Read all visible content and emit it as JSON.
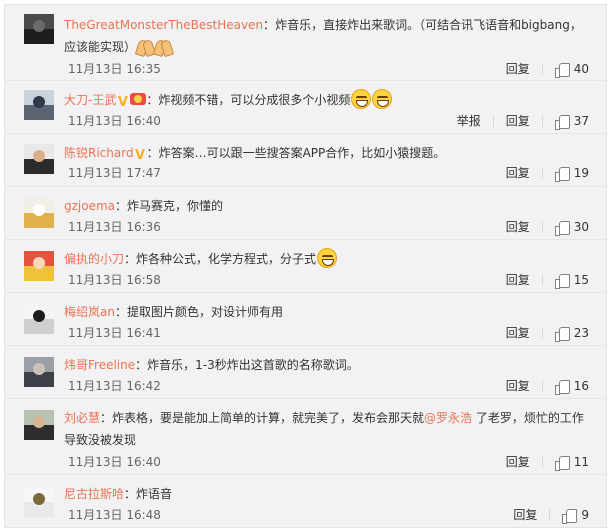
{
  "comments": [
    {
      "user": "TheGreatMonsterTheBestHeaven",
      "sep": "：",
      "text": "炸音乐，直接炸出来歌词。（可结合讯飞语音和bigbang，应该能实现）",
      "time": "11月13日 16:35",
      "reply": "回复",
      "likes": "40",
      "avatar": {
        "top": "#4a4a4a",
        "bottom": "#1e1e1e",
        "head": "#6a6a6a"
      }
    },
    {
      "user": "大刀-王武",
      "sep": "：",
      "text": "炸视频不错，可以分成很多个小视频",
      "time": "11月13日 16:40",
      "report": "举报",
      "reply": "回复",
      "likes": "37",
      "avatar": {
        "top": "#c9d3dc",
        "bottom": "#5b6470",
        "head": "#2d3a4a"
      }
    },
    {
      "user": "陈锐Richard",
      "sep": "：",
      "text": "炸答案…可以跟一些搜答案APP合作，比如小猿搜题。",
      "time": "11月13日 17:47",
      "reply": "回复",
      "likes": "19",
      "avatar": {
        "top": "#e8e8e8",
        "bottom": "#2b2b2b",
        "head": "#d9b08a"
      }
    },
    {
      "user": "gzjoema",
      "sep": "：",
      "text": "炸马赛克，你懂的",
      "time": "11月13日 16:36",
      "reply": "回复",
      "likes": "30",
      "avatar": {
        "top": "#f3efe6",
        "bottom": "#e2b24a",
        "head": "#ffffff"
      }
    },
    {
      "user": "偏执的小刀",
      "sep": "：",
      "text": "炸各种公式，化学方程式，分子式",
      "time": "11月13日 16:58",
      "reply": "回复",
      "likes": "15",
      "avatar": {
        "top": "#e3543f",
        "bottom": "#f0c13a",
        "head": "#f7d9b8"
      }
    },
    {
      "user": "梅绍岚an",
      "sep": "：",
      "text": "提取图片颜色，对设计师有用",
      "time": "11月13日 16:41",
      "reply": "回复",
      "likes": "23",
      "avatar": {
        "top": "#f4f4f4",
        "bottom": "#cfcfcf",
        "head": "#1c1c1c"
      }
    },
    {
      "user": "炜哥Freeline",
      "sep": "：",
      "text": "炸音乐，1-3秒炸出这首歌的名称歌词。",
      "time": "11月13日 16:42",
      "reply": "回复",
      "likes": "16",
      "avatar": {
        "top": "#9aa0a6",
        "bottom": "#3e4248",
        "head": "#c9c2b8"
      }
    },
    {
      "user": "刘必慧",
      "sep": "：",
      "text_before": "炸表格，要是能加上简单的计算，就完美了，发布会那天就",
      "mention": "@罗永浩",
      "text_after": " 了老罗，烦忙的工作导致没被发现",
      "time": "11月13日 16:40",
      "reply": "回复",
      "likes": "11",
      "avatar": {
        "top": "#b8c2b0",
        "bottom": "#2c2c2c",
        "head": "#d6b592"
      }
    },
    {
      "user": "尼古拉斯哈",
      "sep": "：",
      "text": "炸语音",
      "time": "11月13日 16:48",
      "reply": "回复",
      "likes": "9",
      "avatar": {
        "top": "#f6f6f6",
        "bottom": "#e9e9e9",
        "head": "#7a6a3a"
      }
    }
  ],
  "colors": {
    "username": "#eb7350",
    "panel": "#f2f2f5",
    "text": "#333333"
  },
  "icons": {
    "like": "thumbs-up-icon",
    "verified": "verified-v-icon",
    "vip": "vip-badge-icon"
  }
}
